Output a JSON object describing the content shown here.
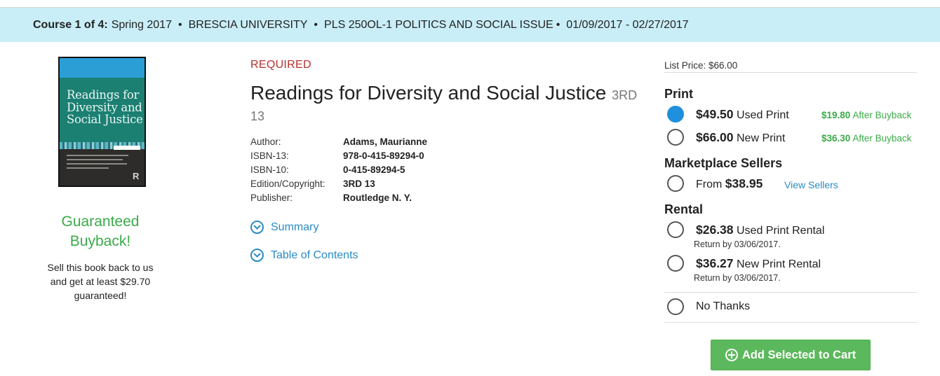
{
  "course": {
    "label": "Course 1 of 4:",
    "term": "Spring 2017",
    "school": "BRESCIA UNIVERSITY",
    "course_name": "PLS 250OL-1 POLITICS AND SOCIAL ISSUE",
    "dates": "01/09/2017 - 02/27/2017",
    "separator": "•"
  },
  "buyback_promo": {
    "title_line1": "Guaranteed",
    "title_line2": "Buyback!",
    "text_line1": "Sell this book back to us",
    "text_line2": "and get at least $29.70",
    "text_line3": "guaranteed!"
  },
  "book": {
    "required_label": "REQUIRED",
    "title": "Readings for Diversity and Social Justice",
    "edition_part1": "3RD",
    "edition_part2": "13",
    "details": [
      {
        "label": "Author:",
        "value": "Adams, Maurianne"
      },
      {
        "label": "ISBN-13:",
        "value": "978-0-415-89294-0"
      },
      {
        "label": "ISBN-10:",
        "value": "0-415-89294-5"
      },
      {
        "label": "Edition/Copyright:",
        "value": "3RD 13"
      },
      {
        "label": "Publisher:",
        "value": "Routledge N. Y."
      }
    ],
    "summary_label": "Summary",
    "toc_label": "Table of Contents"
  },
  "pricing": {
    "list_price": "List Price: $66.00",
    "print_heading": "Print",
    "used_print": {
      "price": "$49.50",
      "label": "Used Print",
      "buyback_amount": "$19.80",
      "buyback_label": "After Buyback",
      "selected": true
    },
    "new_print": {
      "price": "$66.00",
      "label": "New Print",
      "buyback_amount": "$36.30",
      "buyback_label": "After Buyback",
      "selected": false
    },
    "marketplace_heading": "Marketplace Sellers",
    "marketplace": {
      "prefix": "From",
      "price": "$38.95",
      "link": "View Sellers",
      "selected": false
    },
    "rental_heading": "Rental",
    "used_rental": {
      "price": "$26.38",
      "label": "Used Print Rental",
      "return": "Return by 03/06/2017.",
      "selected": false
    },
    "new_rental": {
      "price": "$36.27",
      "label": "New Print Rental",
      "return": "Return by 03/06/2017.",
      "selected": false
    },
    "no_thanks": "No Thanks",
    "add_to_cart": "Add Selected to Cart",
    "colors": {
      "accent_blue": "#1f8fde",
      "buyback_green": "#3aaa48",
      "button_green": "#5cb85c",
      "required_red": "#b8312f",
      "course_bar": "#c9eef7"
    }
  }
}
